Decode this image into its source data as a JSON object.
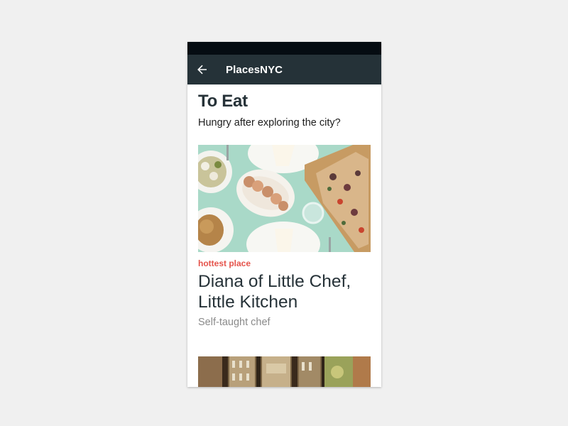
{
  "app_bar": {
    "title": "PlacesNYC",
    "back_icon": "arrow-left-icon"
  },
  "page": {
    "title": "To Eat",
    "subtitle": "Hungry after exploring the city?"
  },
  "cards": [
    {
      "tag": "hottest place",
      "title": "Diana of Little Chef, Little Kitchen",
      "subtitle": "Self-taught chef"
    }
  ],
  "colors": {
    "status_bar": "#050c12",
    "app_bar": "#253238",
    "tag": "#e5534b",
    "title_text": "#263238",
    "subtitle_text": "#8a8a8a"
  }
}
